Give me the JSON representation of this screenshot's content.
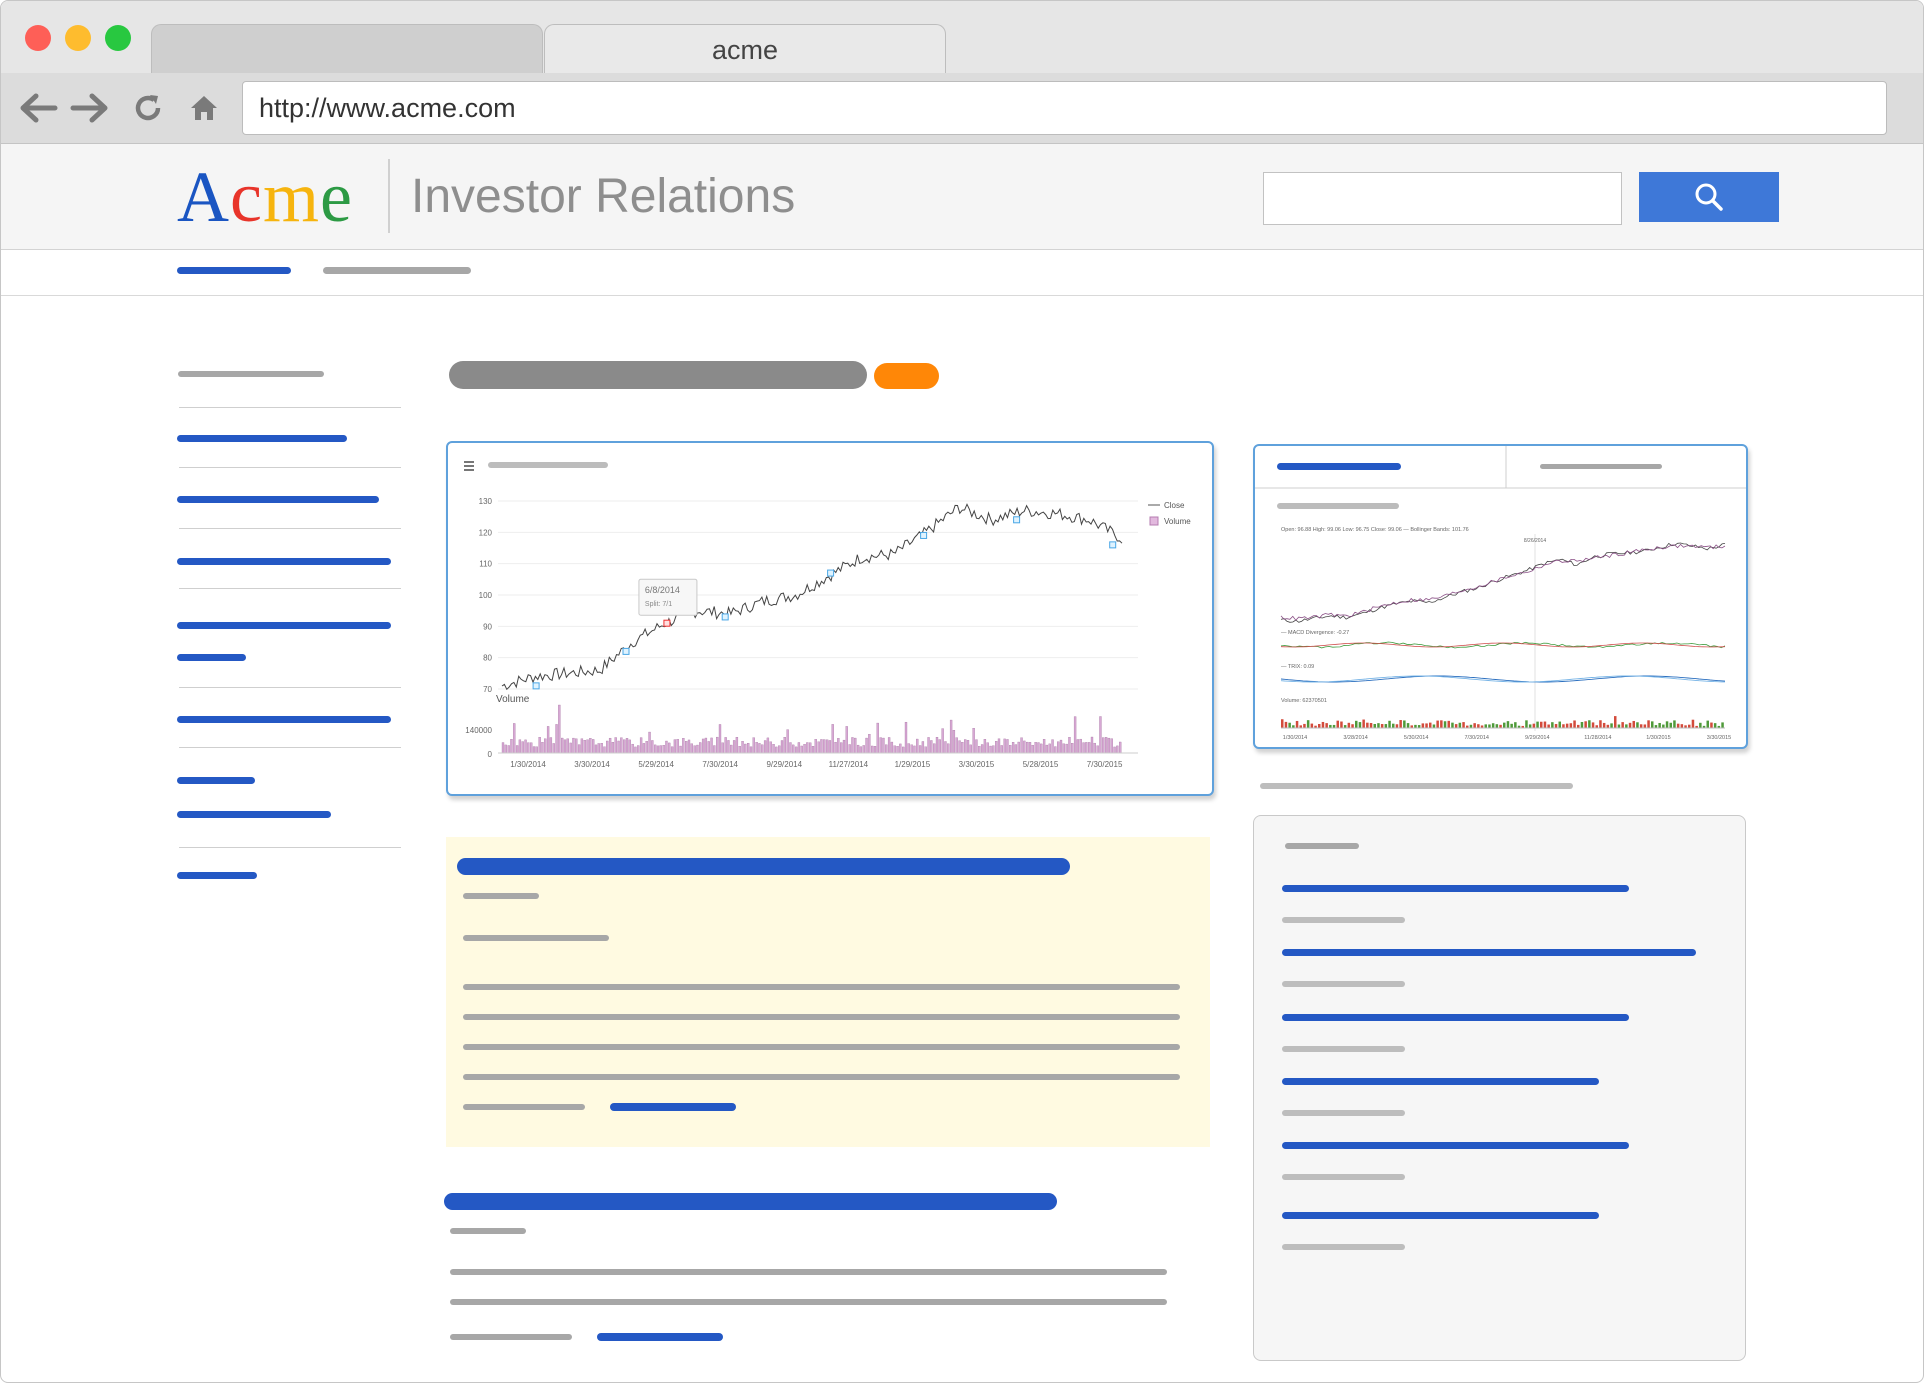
{
  "browser": {
    "tabs": [
      {
        "label": ""
      },
      {
        "label": "acme"
      }
    ],
    "url": "http://www.acme.com",
    "traffic_lights": [
      "#fe5f57",
      "#febc2e",
      "#28c840"
    ]
  },
  "header": {
    "logo_letters": [
      {
        "ch": "A",
        "color": "#1a55c2"
      },
      {
        "ch": "c",
        "color": "#e8342a"
      },
      {
        "ch": "m",
        "color": "#f6b40e"
      },
      {
        "ch": "e",
        "color": "#2c9a44"
      }
    ],
    "title": "Investor Relations",
    "search": {
      "placeholder": "",
      "icon": "search-icon"
    }
  },
  "colors": {
    "link_blue": "#2458c4",
    "accent_orange": "#ff8707",
    "search_blue": "#3e78d8",
    "card_border": "#5fa1dc",
    "highlight_bg": "#fffae1"
  },
  "chart_data": [
    {
      "type": "line",
      "legend": [
        "Close",
        "Volume"
      ],
      "legend_position": "top-right",
      "y_ticks": [
        "130",
        "120",
        "110",
        "100",
        "90",
        "80",
        "70"
      ],
      "ylim": [
        70,
        130
      ],
      "x_ticks": [
        "1/30/2014",
        "3/30/2014",
        "5/29/2014",
        "7/30/2014",
        "9/29/2014",
        "11/27/2014",
        "1/29/2015",
        "3/30/2015",
        "5/28/2015",
        "7/30/2015"
      ],
      "volume_label": "Volume",
      "volume_ticks": [
        "140000",
        "0"
      ],
      "series": [
        {
          "name": "Close",
          "x": [
            "1/30/2014",
            "2/28/2014",
            "3/30/2014",
            "4/30/2014",
            "5/29/2014",
            "6/8/2014",
            "6/30/2014",
            "7/30/2014",
            "8/30/2014",
            "9/29/2014",
            "10/30/2014",
            "11/27/2014",
            "12/30/2014",
            "1/29/2015",
            "2/28/2015",
            "3/30/2015",
            "4/30/2015",
            "5/28/2015",
            "6/30/2015",
            "7/30/2015"
          ],
          "values": [
            71,
            74,
            75,
            76,
            85,
            91,
            95,
            94,
            98,
            100,
            106,
            112,
            113,
            120,
            128,
            124,
            127,
            126,
            124,
            118
          ]
        }
      ],
      "tooltip": {
        "date": "6/8/2014",
        "text": "Split: 7/1"
      }
    },
    {
      "type": "line",
      "info_line": "Open: 96.88   High: 99.06   Low: 96.75   Close: 99.06   — Bollinger Bands: 101.76",
      "marker_date": "8/26/2014",
      "panels": [
        {
          "label": "— MACD Divergence: -0.27"
        },
        {
          "label": "— TRIX: 0.09"
        },
        {
          "label": "Volume: 62370501"
        }
      ],
      "x_ticks": [
        "1/30/2014",
        "3/28/2014",
        "5/30/2014",
        "7/30/2014",
        "9/29/2014",
        "11/28/2014",
        "1/30/2015",
        "3/30/2015"
      ],
      "series": [
        {
          "name": "Close",
          "values": [
            71,
            70,
            72,
            74,
            73,
            76,
            80,
            83,
            85,
            84,
            88,
            92,
            95,
            100,
            104,
            108,
            113,
            116,
            112,
            118,
            120,
            121,
            122,
            125,
            128,
            126,
            124,
            127
          ]
        },
        {
          "name": "Bollinger Bands",
          "values": [
            73,
            72,
            73,
            75,
            74,
            77,
            81,
            84,
            86,
            86,
            89,
            93,
            96,
            100,
            104,
            107,
            112,
            115,
            115,
            117,
            119,
            121,
            123,
            125,
            126,
            126,
            125,
            126
          ]
        }
      ]
    }
  ]
}
